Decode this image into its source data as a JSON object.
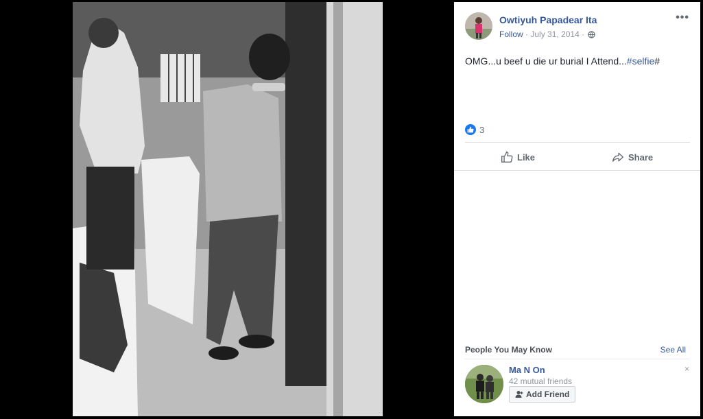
{
  "post": {
    "author": "Owtiyuh Papadear Ita",
    "follow_label": "Follow",
    "separator": "·",
    "date": "July 31, 2014",
    "separator2": "·",
    "more_label": "•••",
    "text": "OMG...u beef u die ur burial I Attend...",
    "hashtag": "#selfie",
    "text_suffix": "#",
    "reaction_count": "3",
    "privacy_icon": "globe-icon"
  },
  "actions": {
    "like_label": "Like",
    "share_label": "Share"
  },
  "pymk": {
    "title": "People You May Know",
    "see_all": "See All",
    "dismiss": "×",
    "person": {
      "name": "Ma N On",
      "mutual": "42 mutual friends",
      "add_label": "Add Friend"
    }
  },
  "colors": {
    "link": "#365899",
    "like_blue": "#1877f2",
    "muted": "#90949c"
  }
}
